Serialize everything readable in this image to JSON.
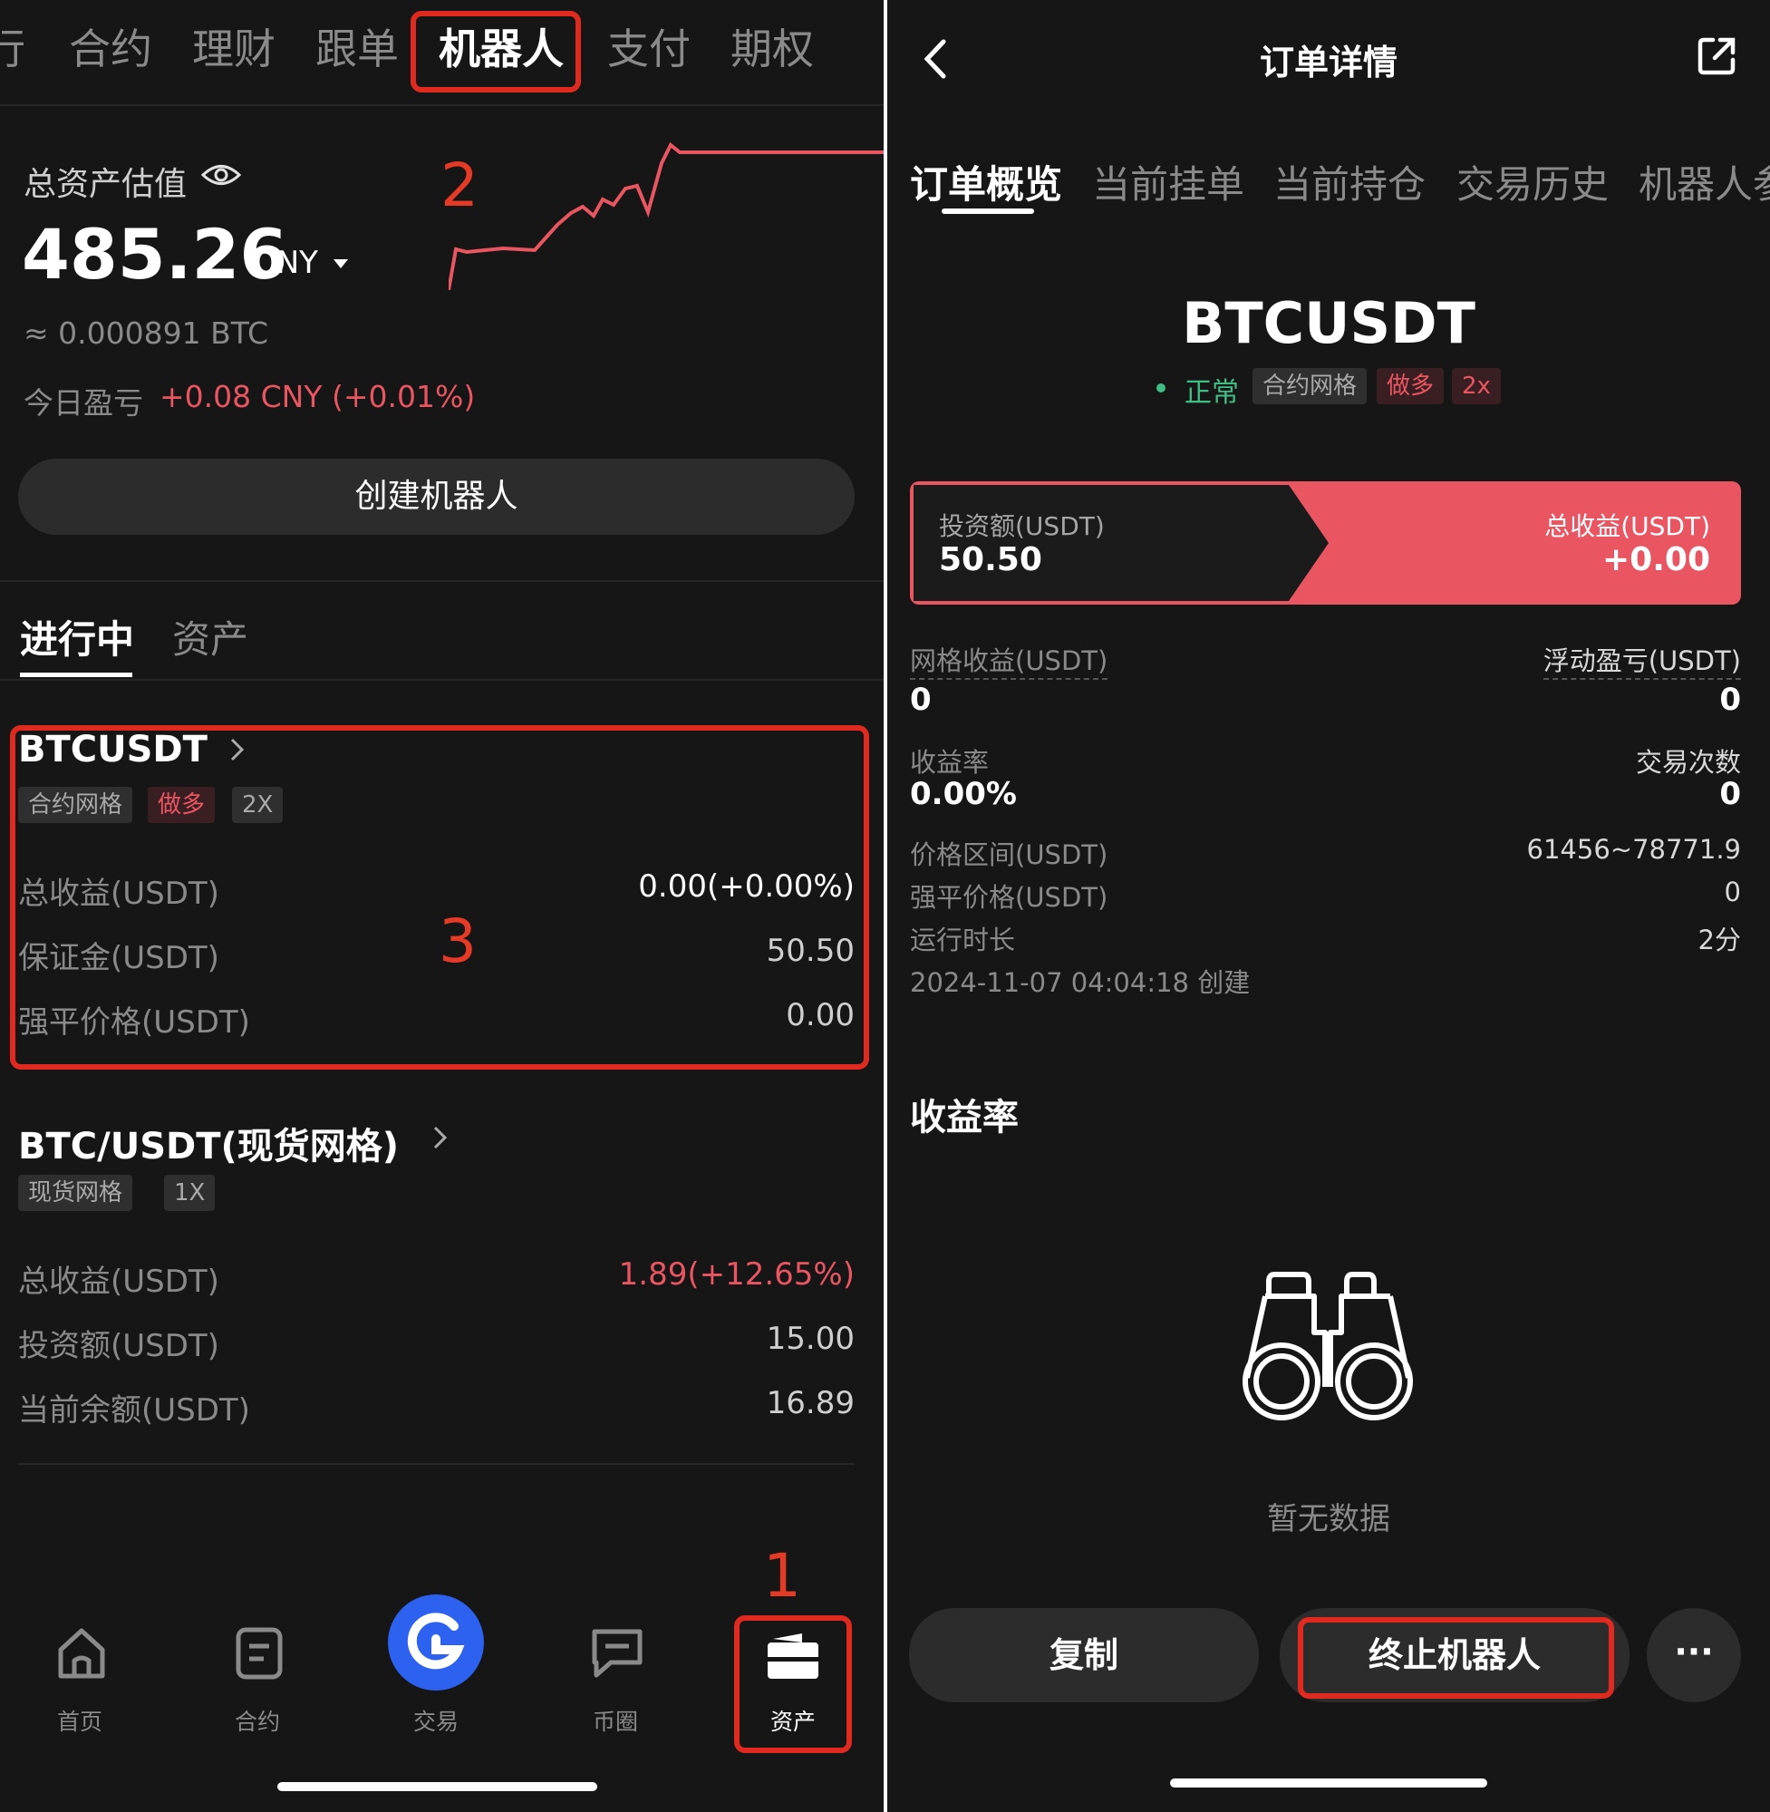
{
  "left": {
    "top_tabs": [
      "行",
      "合约",
      "理财",
      "跟单",
      "机器人",
      "支付",
      "期权"
    ],
    "asset": {
      "label": "总资产估值",
      "value": "485.26",
      "currency": "CNY",
      "btc": "≈ 0.000891 BTC",
      "today_label": "今日盈亏",
      "today_value": "+0.08 CNY (+0.01%)"
    },
    "create_button": "创建机器人",
    "sub_tabs": [
      "进行中",
      "资产"
    ],
    "bot1": {
      "title": "BTCUSDT",
      "tags": [
        "合约网格",
        "做多",
        "2X"
      ],
      "rows": [
        {
          "label": "总收益(USDT)",
          "value": "0.00(+0.00%)"
        },
        {
          "label": "保证金(USDT)",
          "value": "50.50"
        },
        {
          "label": "强平价格(USDT)",
          "value": "0.00"
        }
      ]
    },
    "bot2": {
      "title": "BTC/USDT(现货网格)",
      "tags": [
        "现货网格",
        "1X"
      ],
      "rows": [
        {
          "label": "总收益(USDT)",
          "value": "1.89(+12.65%)"
        },
        {
          "label": "投资额(USDT)",
          "value": "15.00"
        },
        {
          "label": "当前余额(USDT)",
          "value": "16.89"
        }
      ]
    },
    "bottom_nav": [
      "首页",
      "合约",
      "交易",
      "币圈",
      "资产"
    ],
    "annotations": [
      "1",
      "2",
      "3"
    ]
  },
  "right": {
    "header_title": "订单详情",
    "tabs": [
      "订单概览",
      "当前挂单",
      "当前持仓",
      "交易历史",
      "机器人参"
    ],
    "symbol": "BTCUSDT",
    "status": "正常",
    "tags": [
      "合约网格",
      "做多",
      "2x"
    ],
    "invest_label": "投资额(USDT)",
    "invest_value": "50.50",
    "profit_label": "总收益(USDT)",
    "profit_value": "+0.00",
    "grid_profit_label": "网格收益(USDT)",
    "grid_profit_value": "0",
    "float_pnl_label": "浮动盈亏(USDT)",
    "float_pnl_value": "0",
    "rate_label": "收益率",
    "rate_value": "0.00%",
    "trades_label": "交易次数",
    "trades_value": "0",
    "range_label": "价格区间(USDT)",
    "range_value": "61456~78771.9",
    "liq_label": "强平价格(USDT)",
    "liq_value": "0",
    "runtime_label": "运行时长",
    "runtime_value": "2分",
    "created": "2024-11-07 04:04:18 创建",
    "section_title": "收益率",
    "empty_text": "暂无数据",
    "copy_button": "复制",
    "stop_button": "终止机器人",
    "more_button": "···"
  },
  "colors": {
    "background": "#161616",
    "accent_red": "#ea5562",
    "annotation_red": "#e02a20",
    "status_green": "#3fbf86",
    "trade_blue": "#2d62f0"
  }
}
